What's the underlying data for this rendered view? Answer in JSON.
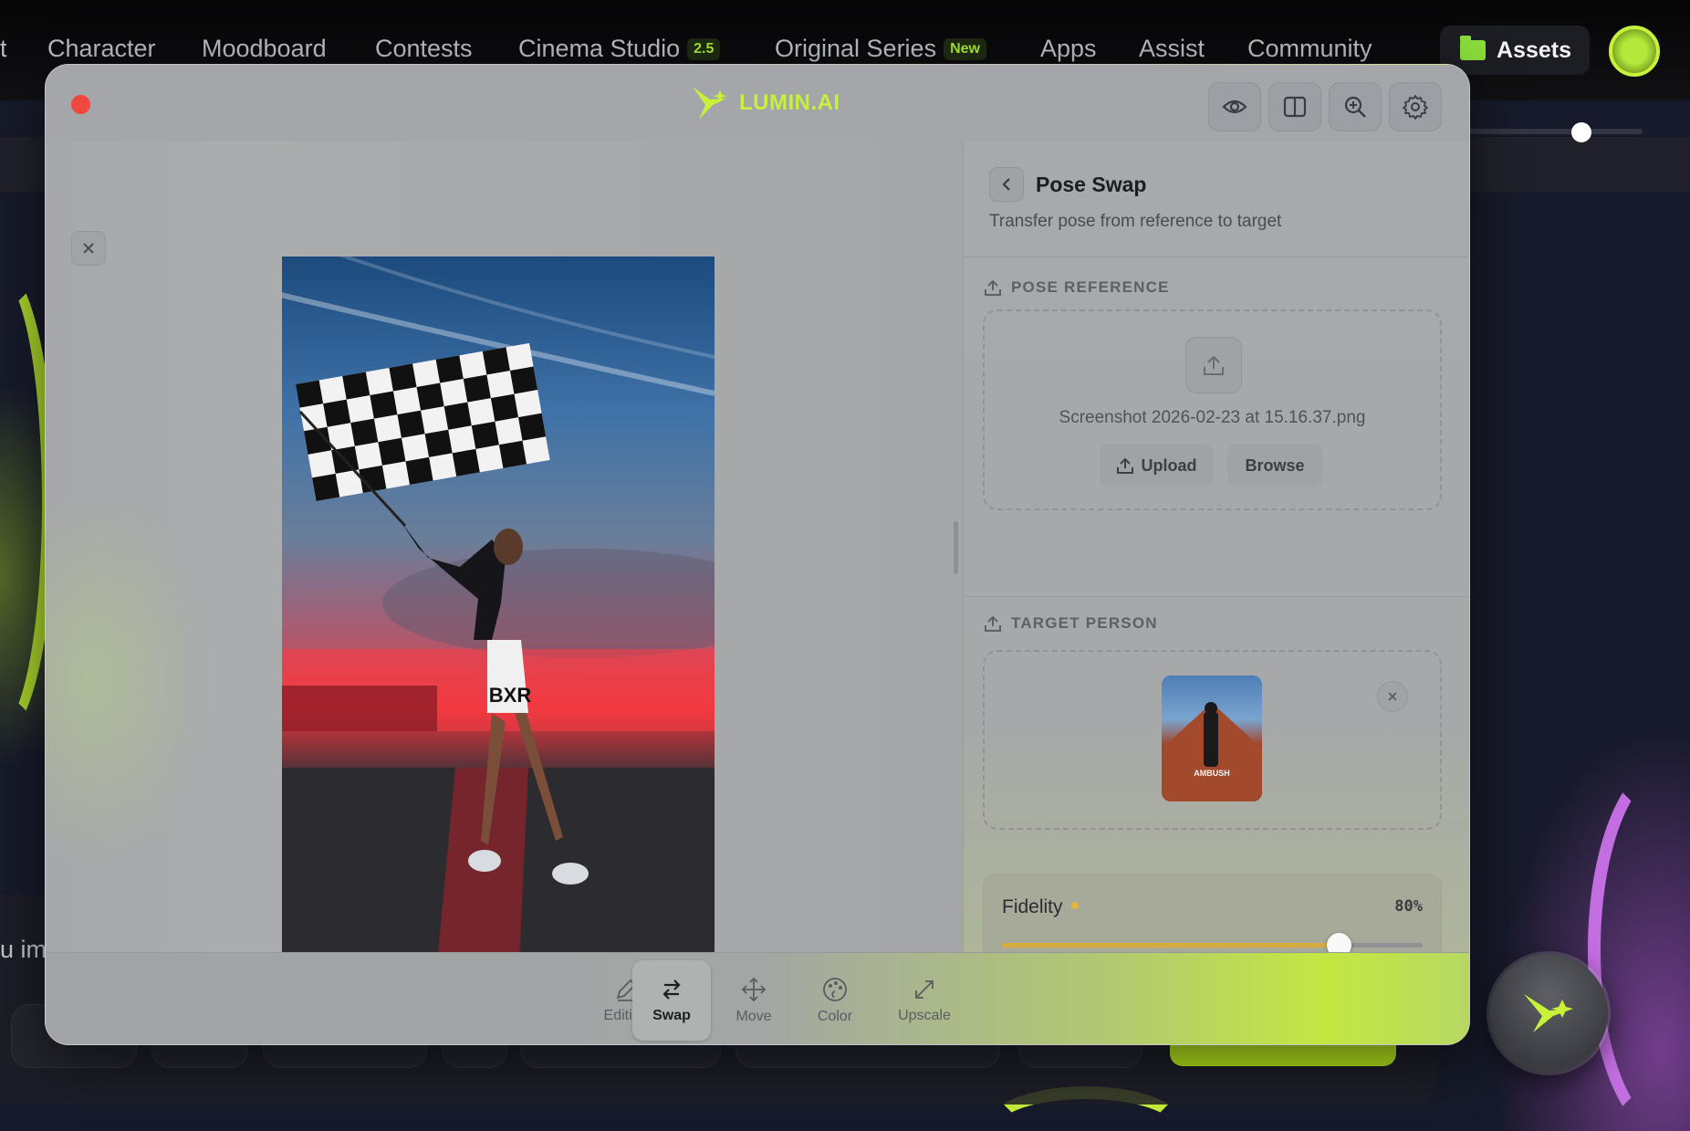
{
  "nav": {
    "partial_item": "t",
    "items": [
      "Character",
      "Moodboard",
      "Contests",
      "Cinema Studio",
      "Original Series",
      "Apps",
      "Assist",
      "Community"
    ],
    "cinema_badge": "2.5",
    "series_badge": "New",
    "assets_label": "Assets"
  },
  "background": {
    "hint_text": "u im"
  },
  "modal": {
    "logo_text": "LUMIN.AI",
    "toolbar_icons": [
      "eye-icon",
      "split-view-icon",
      "zoom-icon",
      "gear-icon"
    ]
  },
  "panel": {
    "title": "Pose Swap",
    "subtitle": "Transfer pose from reference to target",
    "pose_reference": {
      "label": "POSE REFERENCE",
      "filename": "Screenshot 2026-02-23 at 15.16.37.png",
      "upload_label": "Upload",
      "browse_label": "Browse"
    },
    "target_person": {
      "label": "TARGET PERSON",
      "thumb_caption": "AMBUSH"
    },
    "fidelity": {
      "label": "Fidelity",
      "value_text": "80%",
      "value": 0.8
    }
  },
  "photo": {
    "skirt_text": "BXR"
  },
  "tools": [
    {
      "label": "Editing",
      "icon": "pencil-icon",
      "active": false
    },
    {
      "label": "Swap",
      "icon": "swap-icon",
      "active": true
    },
    {
      "label": "Move",
      "icon": "move-icon",
      "active": false
    },
    {
      "label": "Color",
      "icon": "palette-icon",
      "active": false
    },
    {
      "label": "Upscale",
      "icon": "expand-icon",
      "active": false
    }
  ],
  "colors": {
    "accent": "#c8f23a",
    "slider_fill": "#d8ab3c",
    "close_red": "#f0473f"
  }
}
